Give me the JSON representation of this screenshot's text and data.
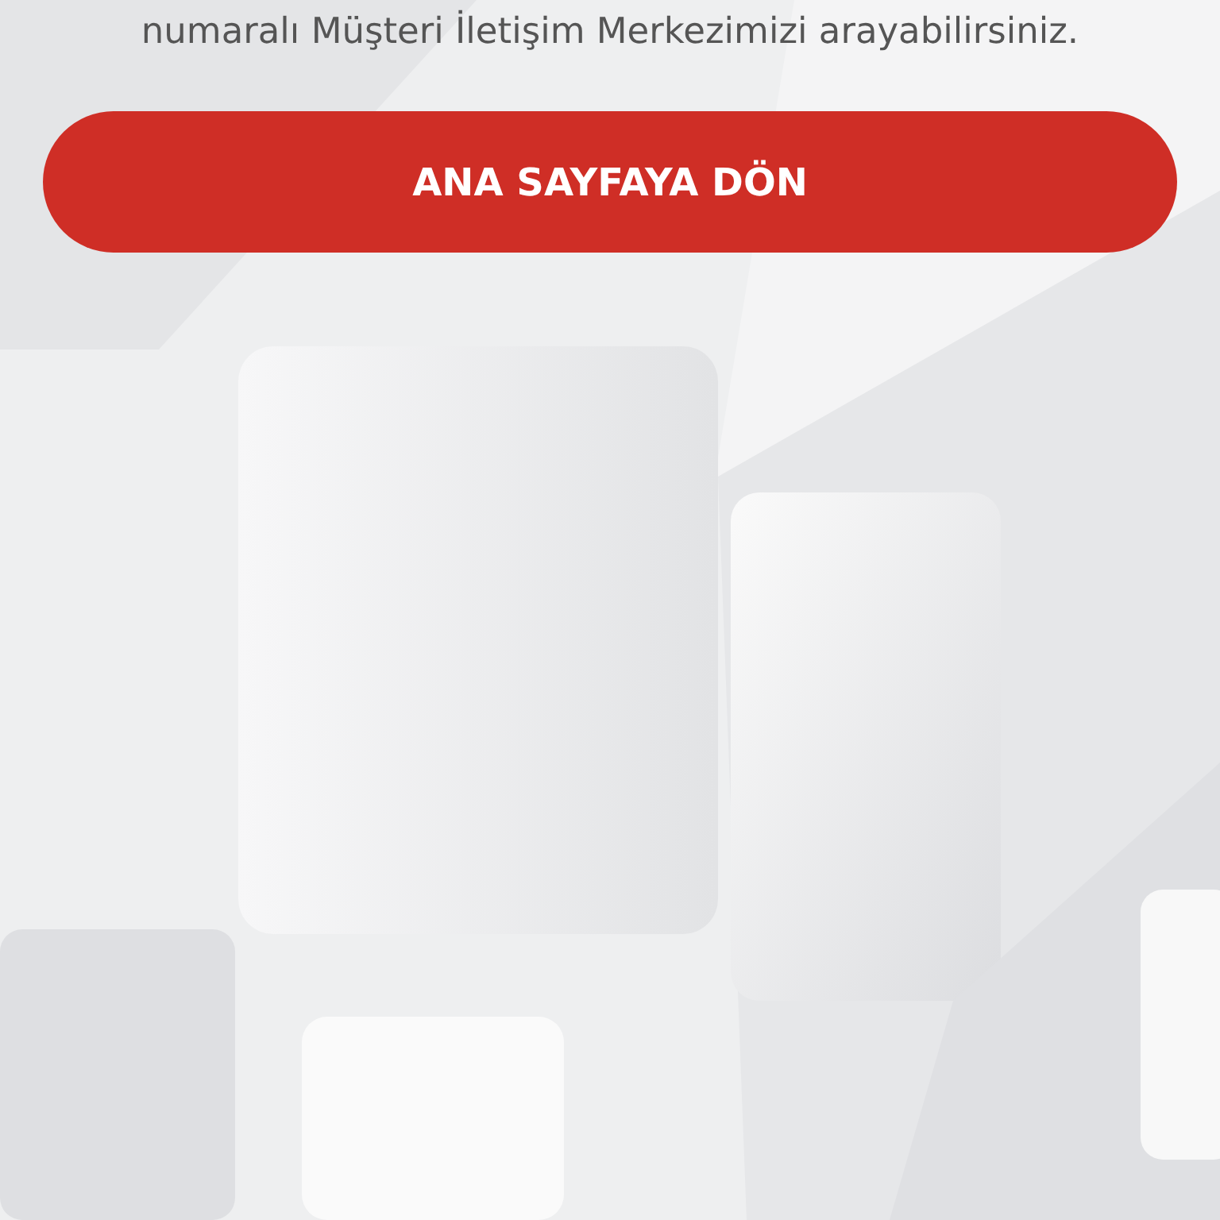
{
  "message": {
    "text": "numaralı Müşteri İletişim Merkezimizi arayabilirsiniz."
  },
  "home_button": {
    "label": "ANA SAYFAYA DÖN"
  }
}
